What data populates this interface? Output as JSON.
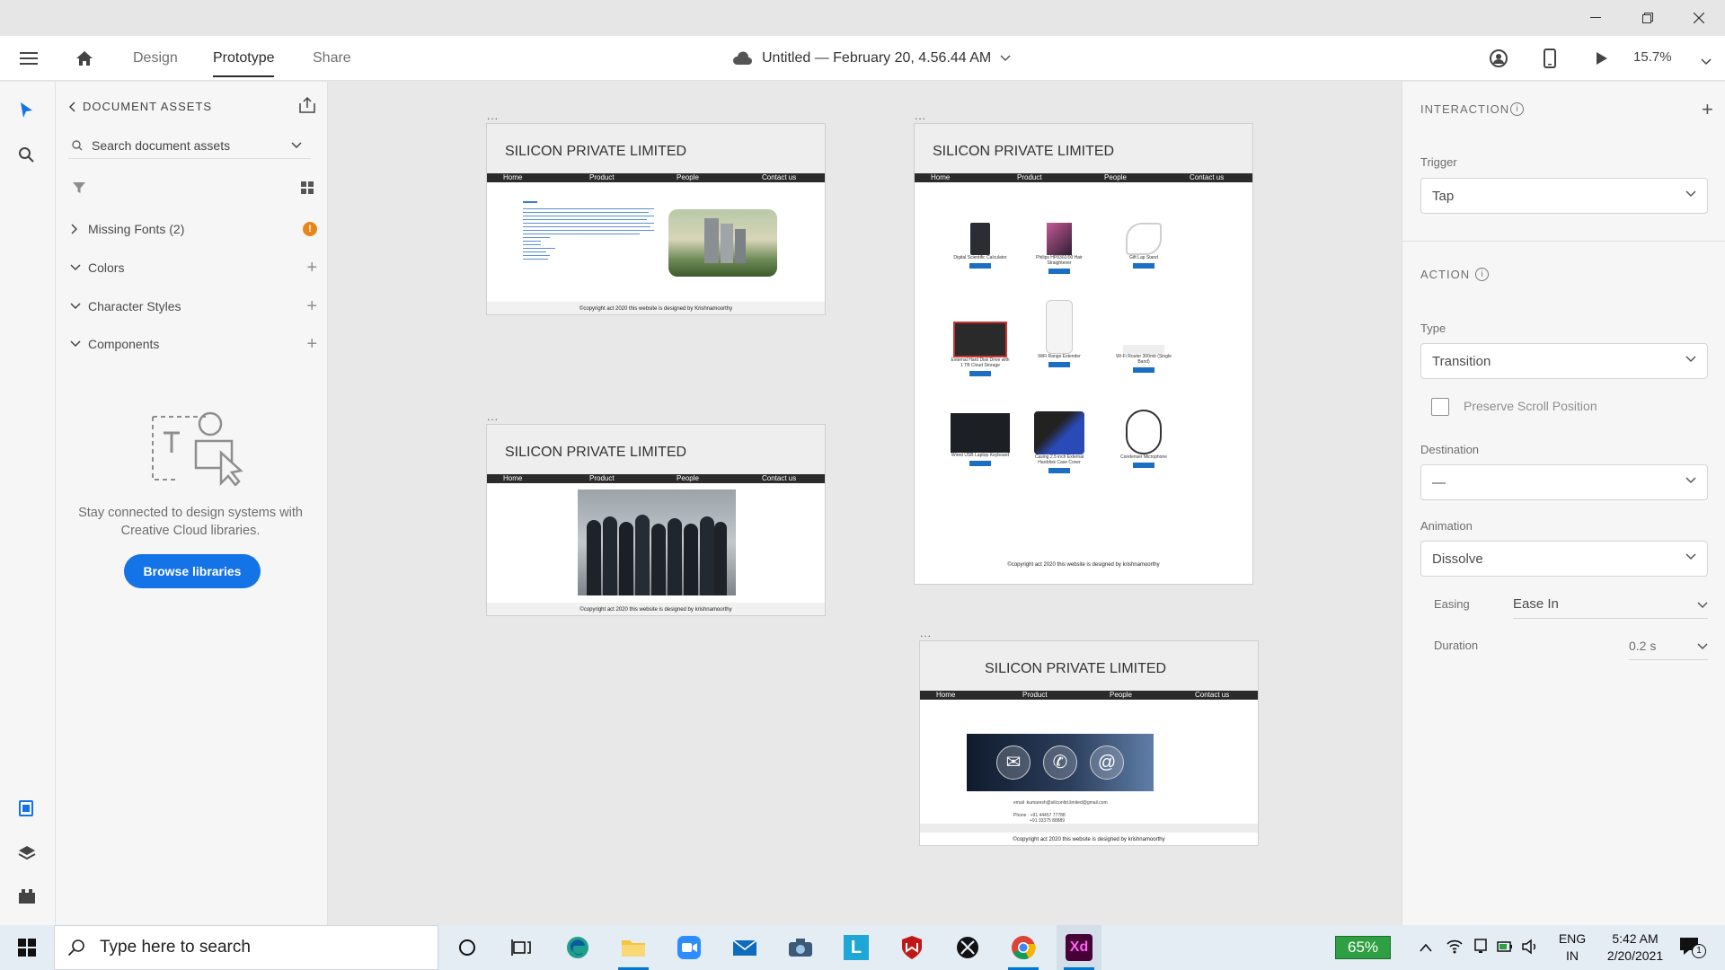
{
  "window": {
    "minimize": "—",
    "restore": "❐",
    "close": "✕"
  },
  "appbar": {
    "tabs": [
      "Design",
      "Prototype",
      "Share"
    ],
    "active_tab": "Prototype",
    "doc_title": "Untitled — February 20, 4.56.44 AM",
    "zoom": "15.7%"
  },
  "assets": {
    "header": "DOCUMENT ASSETS",
    "search_placeholder": "Search document assets",
    "missing_fonts": "Missing Fonts (2)",
    "sections": [
      "Colors",
      "Character Styles",
      "Components"
    ],
    "empty_text": "Stay connected to design systems with Creative Cloud libraries.",
    "browse_button": "Browse libraries"
  },
  "artboards": {
    "company": "SILICON PRIVATE LIMITED",
    "nav": [
      "Home",
      "Product",
      "People",
      "Contact us"
    ],
    "footer_1": "©copyright act 2020 this website is designed by Krishnamoorthy",
    "footer_2": "©copyright act 2020 this website is designed by krishnamoorthy",
    "dots": "...",
    "contact_email": "email :kumaresh@siliconltd.limited@gmail.com",
    "contact_phone_1": "Phone : +91 44457 77788",
    "contact_phone_2": "+91 33375 88889",
    "products": [
      "Digital Scientific Calculator",
      "Philips HP8302/00 Hair Straightener",
      "Gift Lap Stand",
      "External Hard Disk Drive with 1 TB Cloud Storage",
      "WiFi Range Extender",
      "Wi-Fi Router 300mb (Single Band)",
      "Wired USB Laptop Keyboard",
      "Casing 2.5 inch External Harddisk Case Cover",
      "Condenser Microphone"
    ]
  },
  "interaction": {
    "header": "INTERACTION",
    "trigger_label": "Trigger",
    "trigger_value": "Tap",
    "action_header": "ACTION",
    "type_label": "Type",
    "type_value": "Transition",
    "preserve_scroll": "Preserve Scroll Position",
    "destination_label": "Destination",
    "destination_value": "—",
    "animation_label": "Animation",
    "animation_value": "Dissolve",
    "easing_label": "Easing",
    "easing_value": "Ease In",
    "duration_label": "Duration",
    "duration_value": "0.2 s"
  },
  "taskbar": {
    "search_placeholder": "Type here to search",
    "battery": "65%",
    "lang_1": "ENG",
    "lang_2": "IN",
    "time": "5:42 AM",
    "date": "2/20/2021",
    "notifications": "1"
  }
}
